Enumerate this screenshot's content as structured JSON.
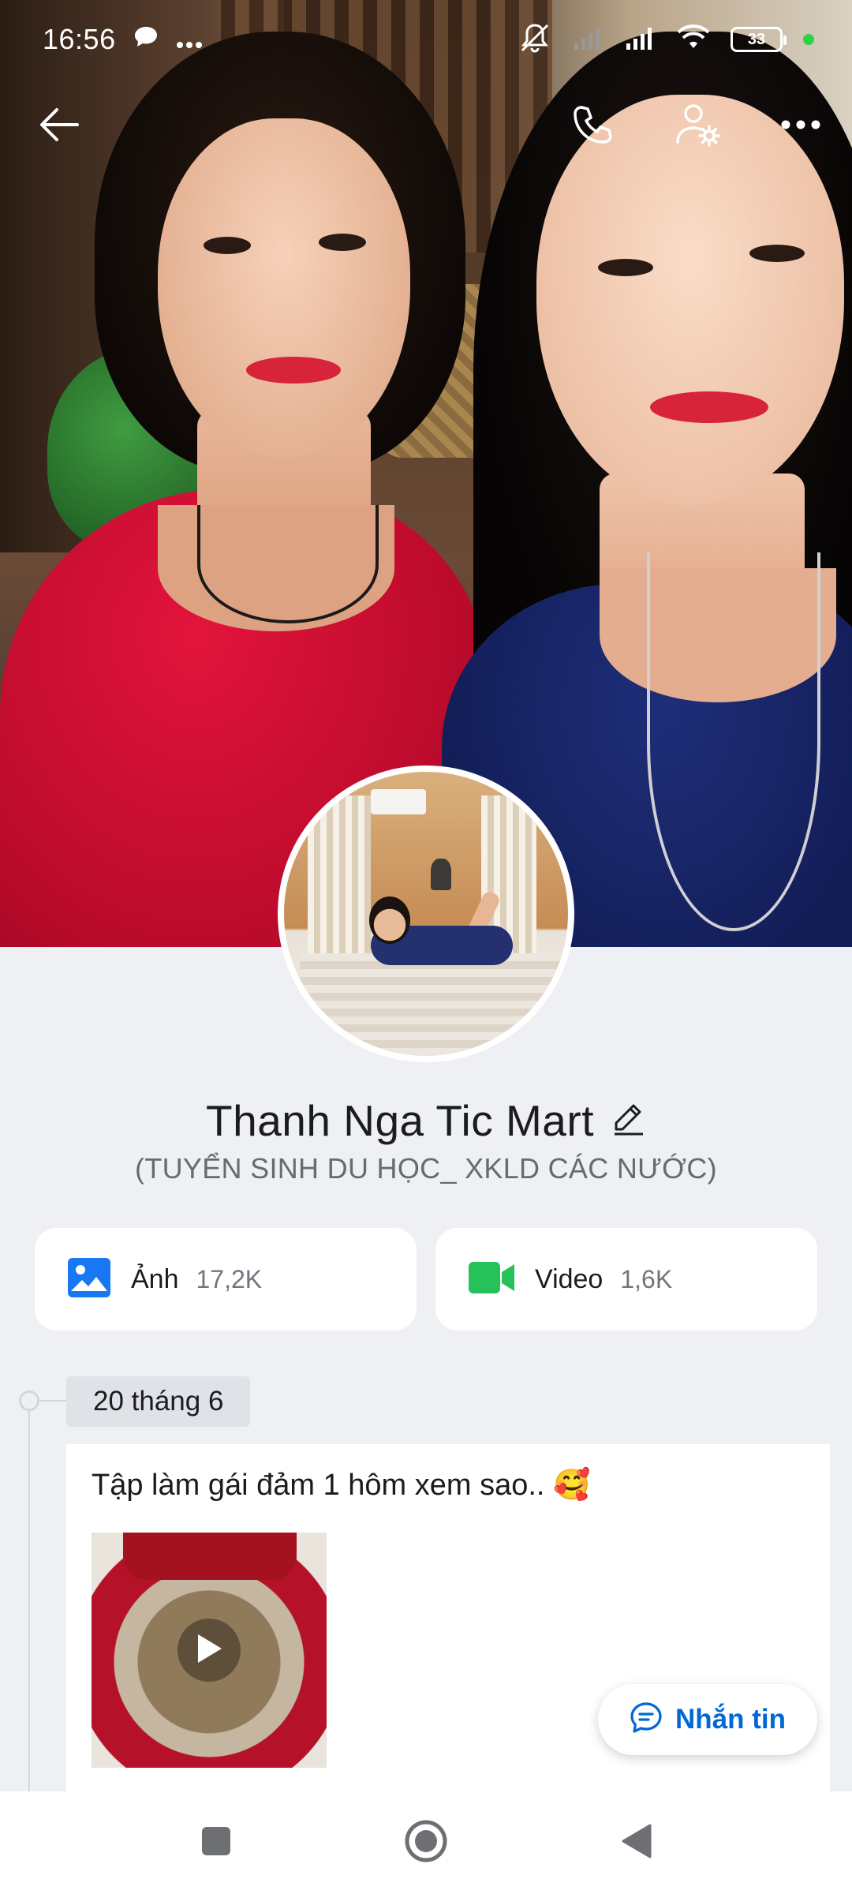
{
  "status_bar": {
    "time": "16:56",
    "battery_level": "33",
    "icons": [
      "chat-bubble-icon",
      "more-dots-icon",
      "mute-icon",
      "signal-icon",
      "signal-icon",
      "wifi-icon",
      "battery-icon"
    ]
  },
  "top_bar": {
    "icons": [
      "back-arrow-icon",
      "phone-icon",
      "profile-settings-icon",
      "more-horizontal-icon"
    ]
  },
  "profile": {
    "name": "Thanh Nga Tic Mart",
    "tagline": "(TUYỂN SINH DU HỌC_ XKLD CÁC NƯỚC)"
  },
  "media": {
    "photos": {
      "label": "Ảnh",
      "count": "17,2K",
      "icon": "image-icon"
    },
    "videos": {
      "label": "Video",
      "count": "1,6K",
      "icon": "video-camera-icon"
    }
  },
  "timeline": {
    "date": "20 tháng 6",
    "post": {
      "text": "Tập làm gái đảm 1 hôm xem sao.. 🥰",
      "media_type": "video"
    }
  },
  "message_button": {
    "label": "Nhắn tin",
    "icon": "chat-icon"
  },
  "colors": {
    "accent_blue": "#0068d6",
    "video_green": "#27c15a",
    "photo_blue": "#1877f2",
    "background": "#eff0f4"
  }
}
